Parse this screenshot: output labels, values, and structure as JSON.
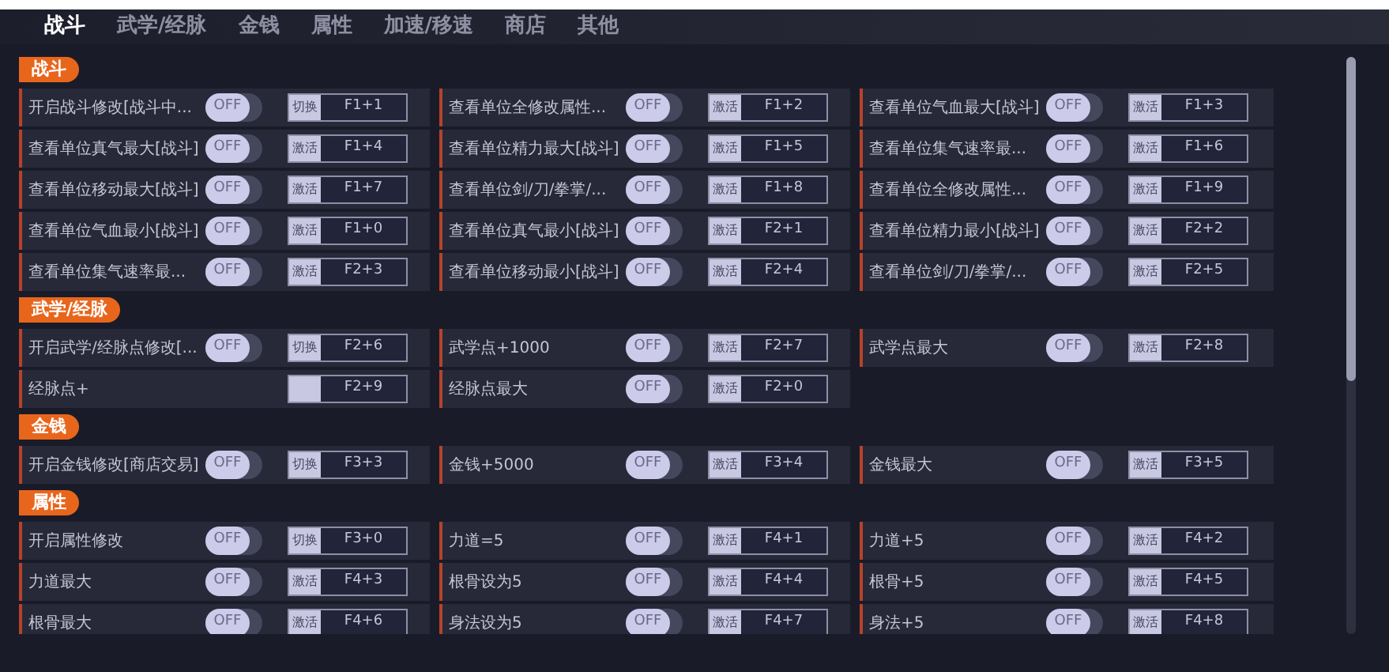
{
  "tabs": [
    {
      "label": "战斗",
      "selected": true
    },
    {
      "label": "武学/经脉",
      "selected": false
    },
    {
      "label": "金钱",
      "selected": false
    },
    {
      "label": "属性",
      "selected": false
    },
    {
      "label": "加速/移速",
      "selected": false
    },
    {
      "label": "商店",
      "selected": false
    },
    {
      "label": "其他",
      "selected": false
    }
  ],
  "sections": [
    {
      "title": "战斗",
      "cells": [
        {
          "label": "开启战斗修改[战斗中...",
          "toggle": {
            "text": "OFF",
            "on": false
          },
          "mode": "切换",
          "key": "F1+1"
        },
        {
          "label": "查看单位全修改属性...",
          "toggle": {
            "text": "OFF",
            "on": false
          },
          "mode": "激活",
          "key": "F1+2"
        },
        {
          "label": "查看单位气血最大[战斗]",
          "toggle": {
            "text": "OFF",
            "on": false
          },
          "mode": "激活",
          "key": "F1+3"
        },
        {
          "label": "查看单位真气最大[战斗]",
          "toggle": {
            "text": "OFF",
            "on": false
          },
          "mode": "激活",
          "key": "F1+4"
        },
        {
          "label": "查看单位精力最大[战斗]",
          "toggle": {
            "text": "OFF",
            "on": false
          },
          "mode": "激活",
          "key": "F1+5"
        },
        {
          "label": "查看单位集气速率最...",
          "toggle": {
            "text": "OFF",
            "on": false
          },
          "mode": "激活",
          "key": "F1+6"
        },
        {
          "label": "查看单位移动最大[战斗]",
          "toggle": {
            "text": "OFF",
            "on": false
          },
          "mode": "激活",
          "key": "F1+7"
        },
        {
          "label": "查看单位剑/刀/拳掌/...",
          "toggle": {
            "text": "OFF",
            "on": false
          },
          "mode": "激活",
          "key": "F1+8"
        },
        {
          "label": "查看单位全修改属性...",
          "toggle": {
            "text": "OFF",
            "on": false
          },
          "mode": "激活",
          "key": "F1+9"
        },
        {
          "label": "查看单位气血最小[战斗]",
          "toggle": {
            "text": "OFF",
            "on": false
          },
          "mode": "激活",
          "key": "F1+0"
        },
        {
          "label": "查看单位真气最小[战斗]",
          "toggle": {
            "text": "OFF",
            "on": false
          },
          "mode": "激活",
          "key": "F2+1"
        },
        {
          "label": "查看单位精力最小[战斗]",
          "toggle": {
            "text": "OFF",
            "on": false
          },
          "mode": "激活",
          "key": "F2+2"
        },
        {
          "label": "查看单位集气速率最...",
          "toggle": {
            "text": "OFF",
            "on": false
          },
          "mode": "激活",
          "key": "F2+3"
        },
        {
          "label": "查看单位移动最小[战斗]",
          "toggle": {
            "text": "OFF",
            "on": false
          },
          "mode": "激活",
          "key": "F2+4"
        },
        {
          "label": "查看单位剑/刀/拳掌/...",
          "toggle": {
            "text": "OFF",
            "on": false
          },
          "mode": "激活",
          "key": "F2+5"
        }
      ]
    },
    {
      "title": "武学/经脉",
      "cells": [
        {
          "label": "开启武学/经脉点修改[...",
          "toggle": {
            "text": "OFF",
            "on": false
          },
          "mode": "切换",
          "key": "F2+6"
        },
        {
          "label": "武学点+1000",
          "toggle": {
            "text": "OFF",
            "on": false
          },
          "mode": "激活",
          "key": "F2+7"
        },
        {
          "label": "武学点最大",
          "toggle": {
            "text": "OFF",
            "on": false
          },
          "mode": "激活",
          "key": "F2+8"
        },
        {
          "label": "经脉点+",
          "key": "F2+9"
        },
        {
          "label": "经脉点最大",
          "toggle": {
            "text": "OFF",
            "on": false
          },
          "mode": "激活",
          "key": "F2+0"
        }
      ]
    },
    {
      "title": "金钱",
      "cells": [
        {
          "label": "开启金钱修改[商店交易]",
          "toggle": {
            "text": "OFF",
            "on": false
          },
          "mode": "切换",
          "key": "F3+3"
        },
        {
          "label": "金钱+5000",
          "toggle": {
            "text": "OFF",
            "on": false
          },
          "mode": "激活",
          "key": "F3+4"
        },
        {
          "label": "金钱最大",
          "toggle": {
            "text": "OFF",
            "on": false
          },
          "mode": "激活",
          "key": "F3+5"
        }
      ]
    },
    {
      "title": "属性",
      "cells": [
        {
          "label": "开启属性修改",
          "toggle": {
            "text": "OFF",
            "on": false
          },
          "mode": "切换",
          "key": "F3+0"
        },
        {
          "label": "力道=5",
          "toggle": {
            "text": "OFF",
            "on": false
          },
          "mode": "激活",
          "key": "F4+1"
        },
        {
          "label": "力道+5",
          "toggle": {
            "text": "OFF",
            "on": false
          },
          "mode": "激活",
          "key": "F4+2"
        },
        {
          "label": "力道最大",
          "toggle": {
            "text": "OFF",
            "on": false
          },
          "mode": "激活",
          "key": "F4+3"
        },
        {
          "label": "根骨设为5",
          "toggle": {
            "text": "OFF",
            "on": false
          },
          "mode": "激活",
          "key": "F4+4"
        },
        {
          "label": "根骨+5",
          "toggle": {
            "text": "OFF",
            "on": false
          },
          "mode": "激活",
          "key": "F4+5"
        },
        {
          "label": "根骨最大",
          "toggle": {
            "text": "OFF",
            "on": false
          },
          "mode": "激活",
          "key": "F4+6"
        },
        {
          "label": "身法设为5",
          "toggle": {
            "text": "OFF",
            "on": false
          },
          "mode": "激活",
          "key": "F4+7"
        },
        {
          "label": "身法+5",
          "toggle": {
            "text": "OFF",
            "on": false
          },
          "mode": "激活",
          "key": "F4+8"
        }
      ]
    }
  ]
}
